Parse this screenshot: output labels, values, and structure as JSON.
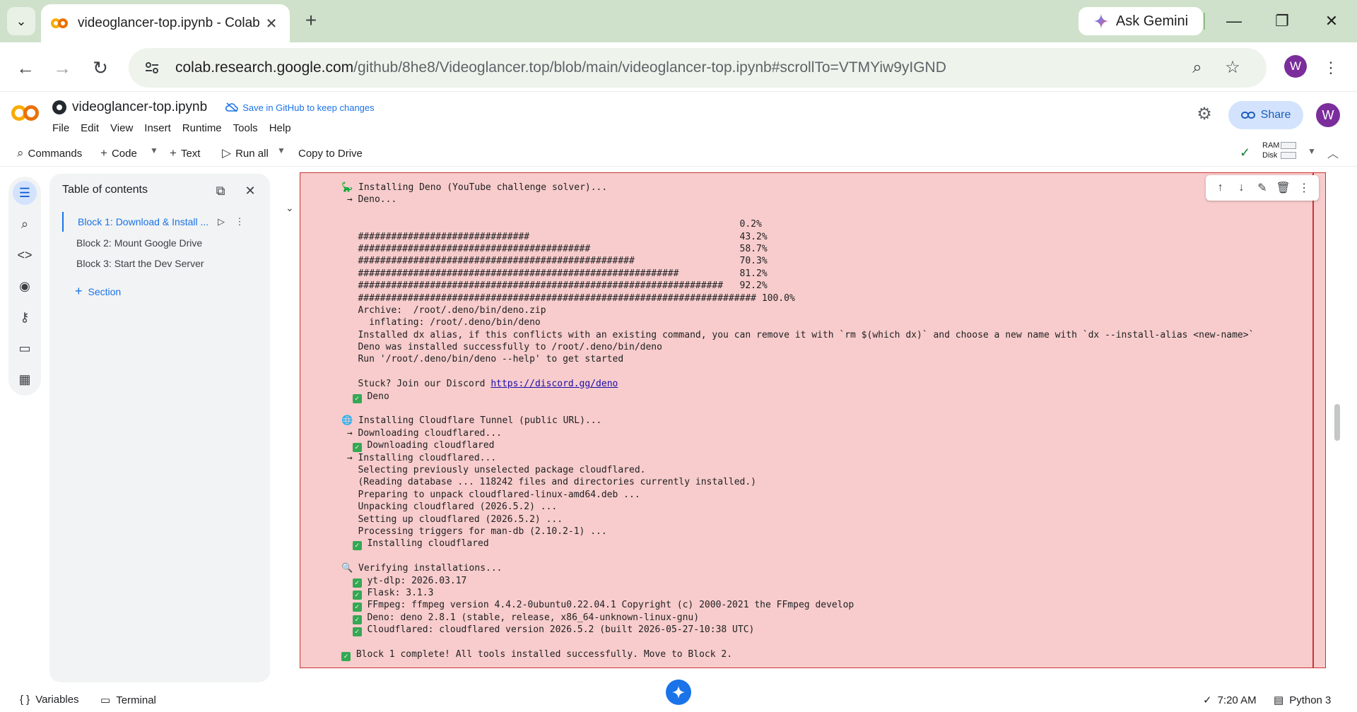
{
  "browser": {
    "tab_title": "videoglancer-top.ipynb - Colab",
    "ask_gemini_label": "Ask Gemini",
    "profile_initial": "W",
    "url_host": "colab.research.google.com",
    "url_path": "/github/8he8/Videoglancer.top/blob/main/videoglancer-top.ipynb#scrollTo=VTMYiw9yIGND"
  },
  "notebook": {
    "title": "videoglancer-top.ipynb",
    "save_hint": "Save in GitHub to keep changes",
    "menu": [
      "File",
      "Edit",
      "View",
      "Insert",
      "Runtime",
      "Tools",
      "Help"
    ],
    "share_label": "Share",
    "avatar_initial": "W"
  },
  "commandbar": {
    "commands_label": "Commands",
    "code_label": "Code",
    "text_label": "Text",
    "run_all_label": "Run all",
    "copy_label": "Copy to Drive",
    "ram_label": "RAM",
    "disk_label": "Disk"
  },
  "toc": {
    "title": "Table of contents",
    "items": [
      {
        "label": "Block 1: Download & Install ..."
      },
      {
        "label": "Block 2: Mount Google Drive"
      },
      {
        "label": "Block 3: Start the Dev Server"
      }
    ],
    "add_section_label": "Section"
  },
  "output": {
    "lines": [
      {
        "icon": "🦕",
        "text": "Installing Deno (YouTube challenge solver)..."
      },
      {
        "text": " → Deno..."
      },
      {
        "text": ""
      },
      {
        "text": "                                                                        0.2%"
      },
      {
        "text": "   ###############################                                      43.2%"
      },
      {
        "text": "   ##########################################                           58.7%"
      },
      {
        "text": "   ##################################################                   70.3%"
      },
      {
        "text": "   ##########################################################           81.2%"
      },
      {
        "text": "   ##################################################################   92.2%"
      },
      {
        "text": "   ######################################################################## 100.0%"
      },
      {
        "text": "   Archive:  /root/.deno/bin/deno.zip"
      },
      {
        "text": "     inflating: /root/.deno/bin/deno"
      },
      {
        "text": "   Installed dx alias, if this conflicts with an existing command, you can remove it with `rm $(which dx)` and choose a new name with `dx --install-alias <new-name>`"
      },
      {
        "text": "   Deno was installed successfully to /root/.deno/bin/deno"
      },
      {
        "text": "   Run '/root/.deno/bin/deno --help' to get started"
      },
      {
        "text": ""
      },
      {
        "text": "   Stuck? Join our Discord ",
        "link": "https://discord.gg/deno"
      },
      {
        "check": true,
        "indent": "  ",
        "text": "Deno"
      },
      {
        "text": ""
      },
      {
        "icon": "🌐",
        "text": "Installing Cloudflare Tunnel (public URL)..."
      },
      {
        "text": " → Downloading cloudflared..."
      },
      {
        "check": true,
        "indent": "  ",
        "text": "Downloading cloudflared"
      },
      {
        "text": " → Installing cloudflared..."
      },
      {
        "text": "   Selecting previously unselected package cloudflared."
      },
      {
        "text": "   (Reading database ... 118242 files and directories currently installed.)"
      },
      {
        "text": "   Preparing to unpack cloudflared-linux-amd64.deb ..."
      },
      {
        "text": "   Unpacking cloudflared (2026.5.2) ..."
      },
      {
        "text": "   Setting up cloudflared (2026.5.2) ..."
      },
      {
        "text": "   Processing triggers for man-db (2.10.2-1) ..."
      },
      {
        "check": true,
        "indent": "  ",
        "text": "Installing cloudflared"
      },
      {
        "text": ""
      },
      {
        "icon": "🔍",
        "text": "Verifying installations..."
      },
      {
        "check": true,
        "indent": "  ",
        "text": "yt-dlp: 2026.03.17"
      },
      {
        "check": true,
        "indent": "  ",
        "text": "Flask: 3.1.3"
      },
      {
        "check": true,
        "indent": "  ",
        "text": "FFmpeg: ffmpeg version 4.4.2-0ubuntu0.22.04.1 Copyright (c) 2000-2021 the FFmpeg develop"
      },
      {
        "check": true,
        "indent": "  ",
        "text": "Deno: deno 2.8.1 (stable, release, x86_64-unknown-linux-gnu)"
      },
      {
        "check": true,
        "indent": "  ",
        "text": "Cloudflared: cloudflared version 2026.5.2 (built 2026-05-27-10:38 UTC)"
      },
      {
        "text": ""
      },
      {
        "check": true,
        "indent": "",
        "text": "Block 1 complete! All tools installed successfully. Move to Block 2."
      }
    ]
  },
  "statusbar": {
    "variables_label": "Variables",
    "terminal_label": "Terminal",
    "time_label": "7:20 AM",
    "kernel_label": "Python 3"
  }
}
